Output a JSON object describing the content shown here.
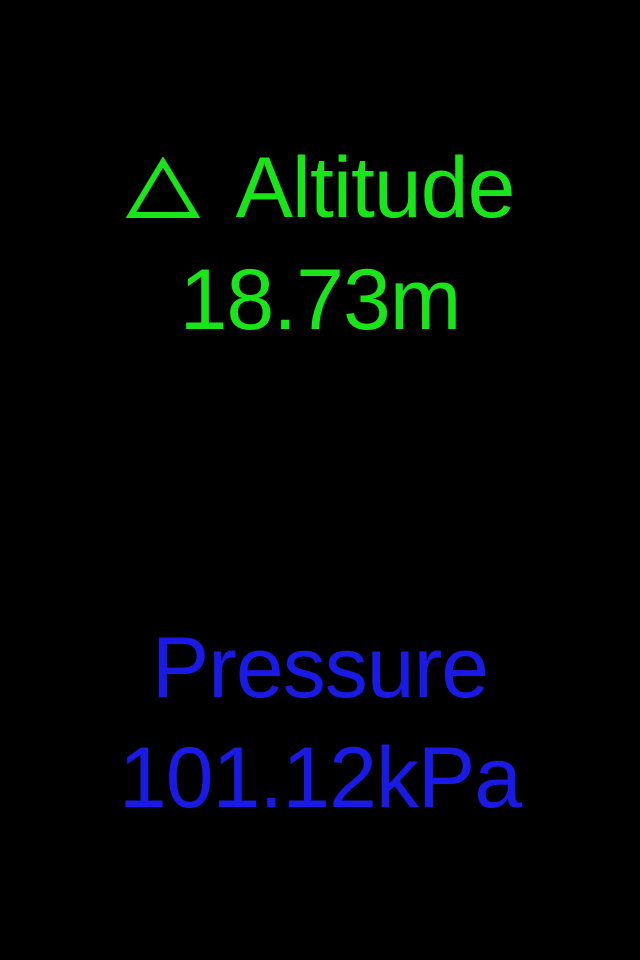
{
  "colors": {
    "background": "#000000",
    "altitude": "#19e619",
    "pressure": "#1a1ae6"
  },
  "altitude": {
    "icon": "delta-icon",
    "label": "Altitude",
    "value": "18.73m"
  },
  "pressure": {
    "label": "Pressure",
    "value": "101.12kPa"
  }
}
